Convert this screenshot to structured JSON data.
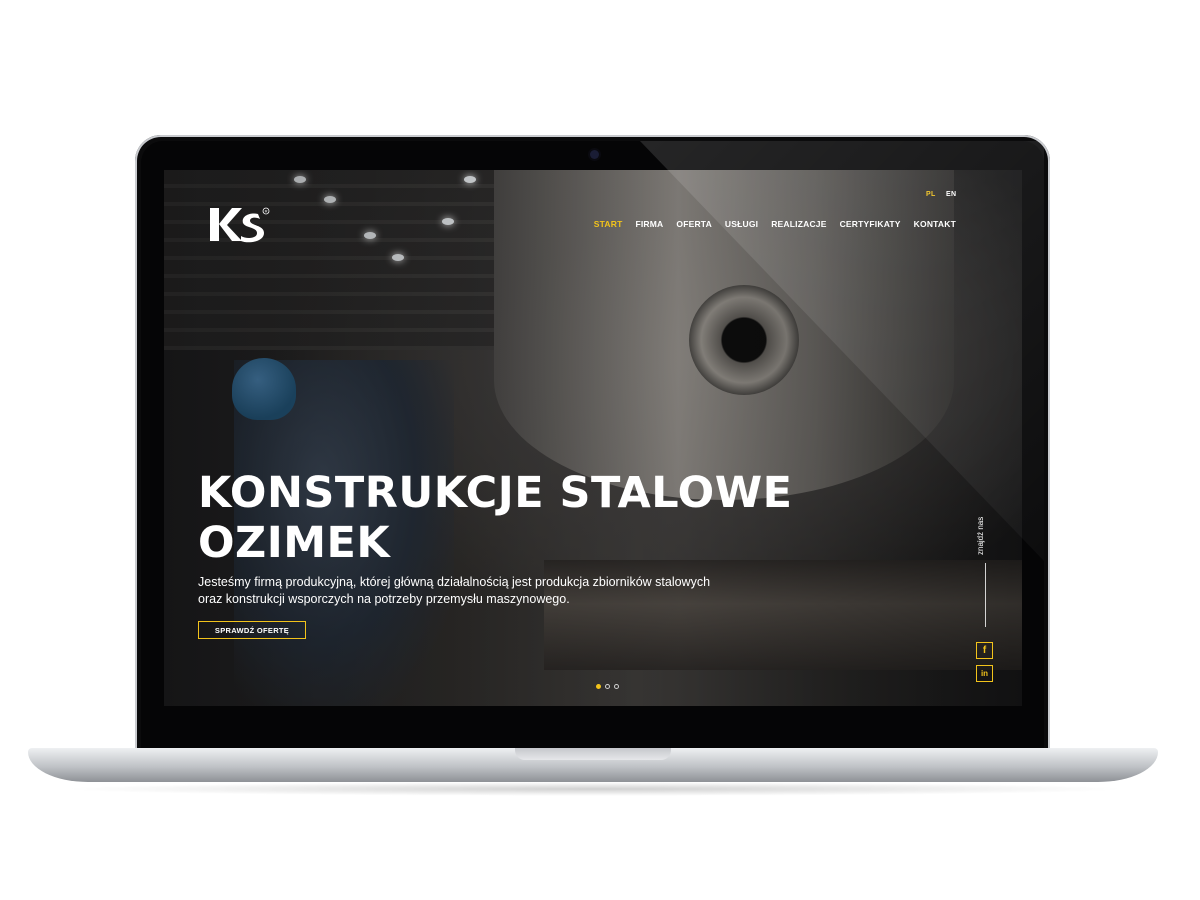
{
  "site": {
    "languages": [
      {
        "label": "PL",
        "active": true
      },
      {
        "label": "EN",
        "active": false
      }
    ],
    "nav": [
      {
        "label": "START",
        "active": true
      },
      {
        "label": "FIRMA",
        "active": false
      },
      {
        "label": "OFERTA",
        "active": false
      },
      {
        "label": "USŁUGI",
        "active": false
      },
      {
        "label": "REALIZACJE",
        "active": false
      },
      {
        "label": "CERTYFIKATY",
        "active": false
      },
      {
        "label": "KONTAKT",
        "active": false
      }
    ],
    "hero": {
      "title_line1": "KONSTRUKCJE STALOWE",
      "title_line2": "OZIMEK",
      "subtitle_line1": "Jesteśmy firmą produkcyjną, której główną działalnością jest produkcja zbiorników stalowych",
      "subtitle_line2": "oraz konstrukcji wsporczych na potrzeby przemysłu maszynowego.",
      "cta_label": "SPRAWDŹ OFERTĘ",
      "slides_total": 3,
      "slide_active": 1
    },
    "side": {
      "find_us": "znajdź nas",
      "social": [
        {
          "icon": "facebook-icon",
          "glyph": "f"
        },
        {
          "icon": "linkedin-icon",
          "glyph": "in"
        }
      ]
    },
    "colors": {
      "accent": "#f2c31b",
      "text": "#ffffff"
    }
  }
}
